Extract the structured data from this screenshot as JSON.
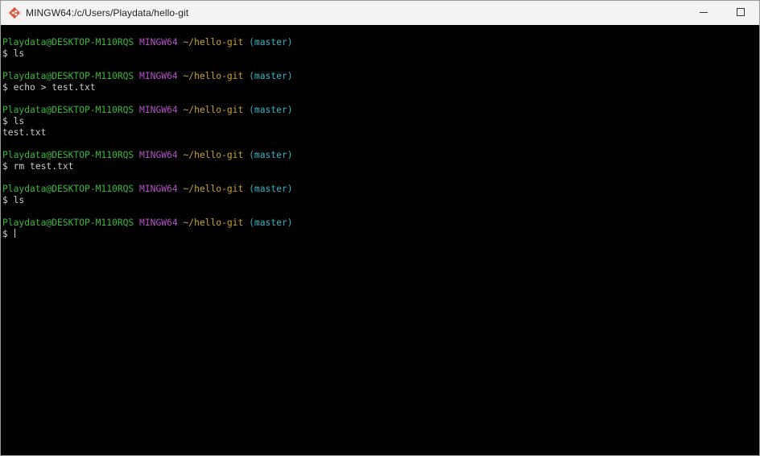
{
  "window": {
    "title": "MINGW64:/c/Users/Playdata/hello-git",
    "app_icon": "git-icon",
    "controls": [
      "minimize-icon",
      "maximize-icon"
    ]
  },
  "colors": {
    "user": "#3ab83a",
    "host": "#b451c8",
    "path": "#c9a227",
    "branch": "#2fb3c7",
    "text": "#cccccc",
    "background": "#000000"
  },
  "prompt": {
    "user_host": "Playdata@DESKTOP-M110RQS",
    "system": "MINGW64",
    "path": "~/hello-git",
    "branch": "(master)",
    "symbol": "$"
  },
  "terminal": {
    "blocks": [
      {
        "command": "ls",
        "output": []
      },
      {
        "command": "echo > test.txt",
        "output": []
      },
      {
        "command": "ls",
        "output": [
          "test.txt"
        ]
      },
      {
        "command": "rm test.txt",
        "output": []
      },
      {
        "command": "ls",
        "output": []
      },
      {
        "command": "",
        "output": []
      }
    ]
  }
}
